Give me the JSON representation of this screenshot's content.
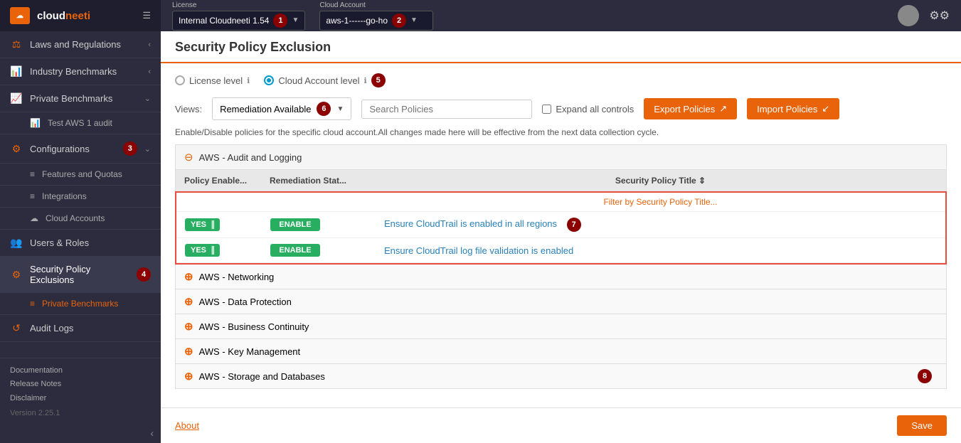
{
  "sidebar": {
    "logo": "cloudneeti",
    "logo_highlight": "neeti",
    "nav_items": [
      {
        "id": "laws",
        "icon": "⚖",
        "label": "Laws and Regulations",
        "has_chevron": true
      },
      {
        "id": "industry",
        "icon": "📊",
        "label": "Industry Benchmarks",
        "has_chevron": true
      },
      {
        "id": "private",
        "icon": "📈",
        "label": "Private Benchmarks",
        "has_chevron": true
      },
      {
        "id": "test_aws",
        "icon": "📊",
        "label": "Test AWS 1 audit",
        "is_sub": true
      },
      {
        "id": "configurations",
        "icon": "⚙",
        "label": "Configurations",
        "has_chevron": true,
        "badge": "3"
      },
      {
        "id": "features",
        "icon": "≡",
        "label": "Features and Quotas",
        "is_sub": true
      },
      {
        "id": "integrations",
        "icon": "≡",
        "label": "Integrations",
        "is_sub": true
      },
      {
        "id": "cloud_accounts",
        "icon": "☁",
        "label": "Cloud Accounts",
        "is_sub": true
      },
      {
        "id": "users_roles",
        "icon": "👥",
        "label": "Users & Roles",
        "is_sub": false
      },
      {
        "id": "security_policy",
        "icon": "⚙",
        "label": "Security Policy Exclusions",
        "is_sub": false,
        "badge": "4",
        "active": true
      },
      {
        "id": "private_benchmarks_sub",
        "icon": "≡",
        "label": "Private Benchmarks",
        "is_sub": true
      },
      {
        "id": "audit_logs",
        "icon": "↺",
        "label": "Audit Logs",
        "is_sub": false
      }
    ],
    "footer": {
      "documentation": "Documentation",
      "release_notes": "Release Notes",
      "disclaimer": "Disclaimer",
      "version": "Version 2.25.1"
    }
  },
  "topbar": {
    "license_label": "License",
    "license_value": "Internal Cloudneeti 1.54",
    "license_badge": "1",
    "cloud_account_label": "Cloud Account",
    "cloud_account_value": "aws-1------go-ho",
    "cloud_account_badge": "2"
  },
  "page": {
    "title": "Security Policy Exclusion",
    "level_options": [
      {
        "id": "license",
        "label": "License level",
        "selected": false
      },
      {
        "id": "cloud_account",
        "label": "Cloud Account level",
        "selected": true
      }
    ],
    "level_badge": "5",
    "views_label": "Views:",
    "views_value": "Remediation Available",
    "views_badge": "6",
    "search_placeholder": "Search Policies",
    "expand_label": "Expand all controls",
    "export_label": "Export Policies",
    "import_label": "Import Policies",
    "info_text": "Enable/Disable policies for the specific cloud account.All changes made here will be effective from the next data collection cycle.",
    "table_badge": "7",
    "scroll_badge": "8"
  },
  "table": {
    "col1": "Policy Enable...",
    "col2": "Remediation Stat...",
    "col3": "Security Policy Title ⇕",
    "filter_placeholder": "Filter by Security Policy Title...",
    "groups": [
      {
        "name": "AWS - Audit and Logging",
        "expanded": true,
        "rows": [
          {
            "toggle": "YES",
            "remediation": "ENABLE",
            "title": "Ensure CloudTrail is enabled in all regions"
          },
          {
            "toggle": "YES",
            "remediation": "ENABLE",
            "title": "Ensure CloudTrail log file validation is enabled"
          }
        ]
      },
      {
        "name": "AWS - Networking",
        "expanded": false
      },
      {
        "name": "AWS - Data Protection",
        "expanded": false
      },
      {
        "name": "AWS - Business Continuity",
        "expanded": false
      },
      {
        "name": "AWS - Key Management",
        "expanded": false
      },
      {
        "name": "AWS - Storage and Databases",
        "expanded": false
      }
    ]
  },
  "bottom": {
    "about_label": "About",
    "save_label": "Save"
  }
}
